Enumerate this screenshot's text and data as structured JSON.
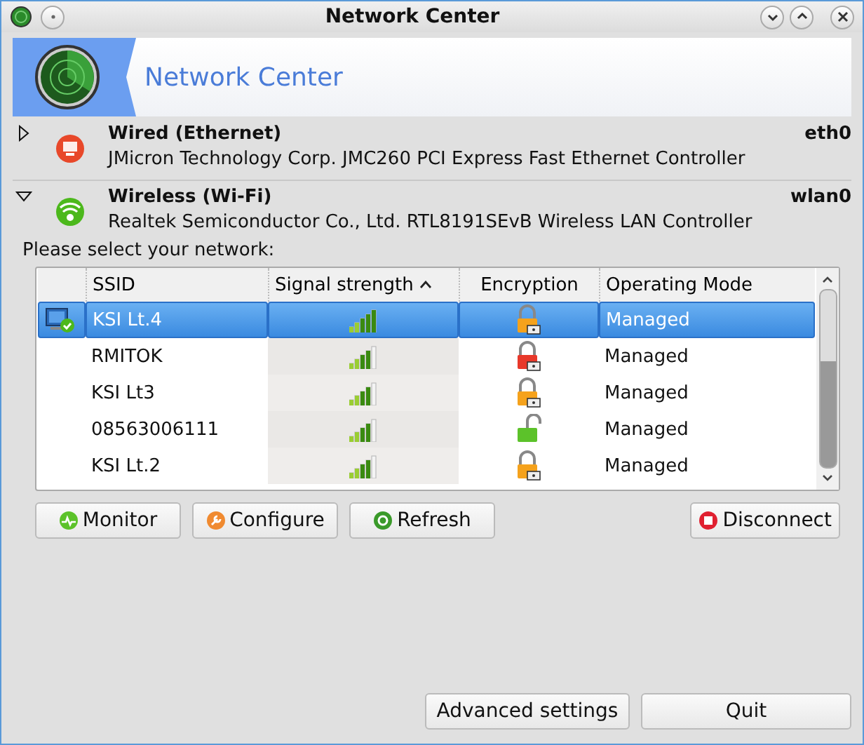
{
  "window": {
    "title": "Network Center"
  },
  "banner": {
    "title": "Network Center"
  },
  "devices": [
    {
      "kind": "wired",
      "name": "Wired (Ethernet)",
      "interface": "eth0",
      "description": "JMicron Technology Corp. JMC260 PCI Express Fast Ethernet Controller",
      "expanded": false,
      "color": "#e8482a"
    },
    {
      "kind": "wireless",
      "name": "Wireless (Wi-Fi)",
      "interface": "wlan0",
      "description": "Realtek Semiconductor Co., Ltd. RTL8191SEvB Wireless LAN Controller",
      "expanded": true,
      "color": "#4cb81c"
    }
  ],
  "prompt": "Please select your network:",
  "table": {
    "columns": [
      {
        "label": "SSID",
        "sorted": false
      },
      {
        "label": "Signal strength",
        "sorted": true
      },
      {
        "label": "Encryption",
        "sorted": false
      },
      {
        "label": "Operating Mode",
        "sorted": false
      }
    ],
    "rows": [
      {
        "ssid": "KSI Lt.4",
        "signal": {
          "level": 1
        },
        "lock": {
          "locked": true,
          "color": "#f5a21c"
        },
        "mode": "Managed",
        "selected": true,
        "connected": true
      },
      {
        "ssid": "RMITOK",
        "signal": {
          "level": 0.8
        },
        "lock": {
          "locked": true,
          "color": "#e8382a"
        },
        "mode": "Managed",
        "selected": false,
        "connected": false
      },
      {
        "ssid": "KSI Lt3",
        "signal": {
          "level": 0.8
        },
        "lock": {
          "locked": true,
          "color": "#f5a21c"
        },
        "mode": "Managed",
        "selected": false,
        "connected": false
      },
      {
        "ssid": "08563006111",
        "signal": {
          "level": 0.8
        },
        "lock": {
          "locked": false,
          "color": "#5cc22a"
        },
        "mode": "Managed",
        "selected": false,
        "connected": false
      },
      {
        "ssid": "KSI Lt.2",
        "signal": {
          "level": 0.8
        },
        "lock": {
          "locked": true,
          "color": "#f5a21c"
        },
        "mode": "Managed",
        "selected": false,
        "connected": false
      }
    ]
  },
  "actions": [
    {
      "kind": "monitor",
      "label": "Monitor",
      "color": "#5cc22a"
    },
    {
      "kind": "configure",
      "label": "Configure",
      "color": "#f08a30"
    },
    {
      "kind": "refresh",
      "label": "Refresh",
      "color": "#3a9a2a"
    },
    {
      "kind": "disconnect",
      "label": "Disconnect",
      "color": "#e02030"
    }
  ],
  "footer_buttons": [
    "Advanced settings",
    "Quit"
  ]
}
